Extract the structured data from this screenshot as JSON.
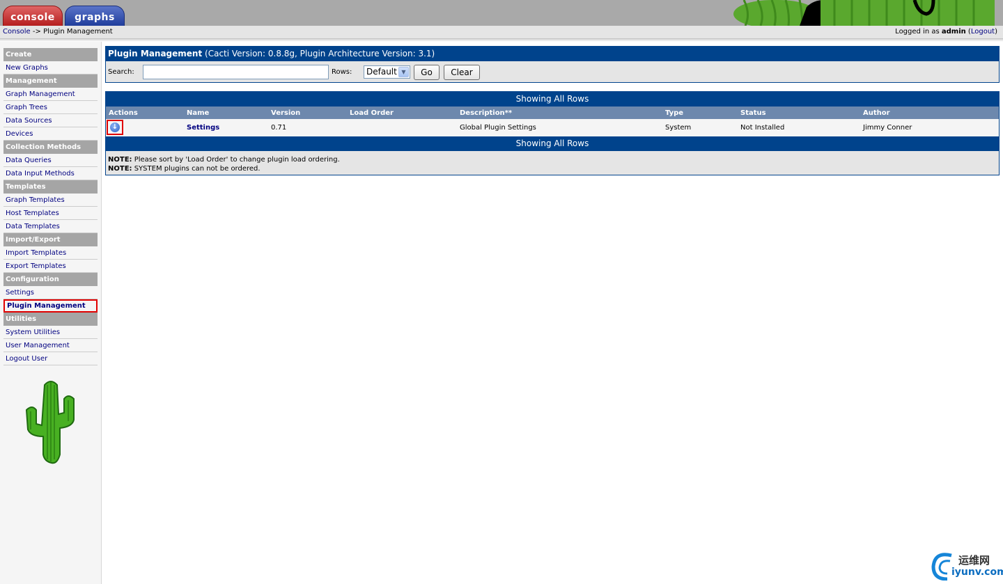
{
  "tabs": {
    "console": "console",
    "graphs": "graphs"
  },
  "breadcrumb": {
    "link": "Console",
    "separator": " -> ",
    "current": "Plugin Management"
  },
  "login": {
    "prefix": "Logged in as ",
    "user": "admin",
    "logout_open": " (",
    "logout": "Logout",
    "logout_close": ")"
  },
  "sidebar": {
    "sections": [
      {
        "header": "Create",
        "items": [
          "New Graphs"
        ]
      },
      {
        "header": "Management",
        "items": [
          "Graph Management",
          "Graph Trees",
          "Data Sources",
          "Devices"
        ]
      },
      {
        "header": "Collection Methods",
        "items": [
          "Data Queries",
          "Data Input Methods"
        ]
      },
      {
        "header": "Templates",
        "items": [
          "Graph Templates",
          "Host Templates",
          "Data Templates"
        ]
      },
      {
        "header": "Import/Export",
        "items": [
          "Import Templates",
          "Export Templates"
        ]
      },
      {
        "header": "Configuration",
        "items": [
          "Settings",
          "Plugin Management"
        ]
      },
      {
        "header": "Utilities",
        "items": [
          "System Utilities",
          "User Management",
          "Logout User"
        ]
      }
    ],
    "selected": "Plugin Management"
  },
  "main": {
    "title": "Plugin Management",
    "title_detail": " (Cacti Version: 0.8.8g, Plugin Architecture Version: 3.1)",
    "filter": {
      "search_label": "Search:",
      "search_value": "",
      "rows_label": "Rows:",
      "rows_value": "Default",
      "go": "Go",
      "clear": "Clear"
    },
    "table": {
      "top_bar": "Showing All Rows",
      "bottom_bar": "Showing All Rows",
      "columns": [
        "Actions",
        "Name",
        "Version",
        "Load Order",
        "Description**",
        "Type",
        "Status",
        "Author"
      ],
      "rows": [
        {
          "action_icon": "install-icon",
          "name": "Settings",
          "version": "0.71",
          "load_order": "",
          "description": "Global Plugin Settings",
          "type": "System",
          "status": "Not Installed",
          "author": "Jimmy Conner"
        }
      ]
    },
    "notes": [
      {
        "label": "NOTE:",
        "text": " Please sort by 'Load Order' to change plugin load ordering."
      },
      {
        "label": "NOTE:",
        "text": " SYSTEM plugins can not be ordered."
      }
    ]
  },
  "watermark": {
    "line1": "运维网",
    "line2": "iyunv.com"
  },
  "colors": {
    "header_blue": "#00438c",
    "column_header": "#6d88ad",
    "menu_header": "#a5a5a5",
    "link": "#000080",
    "highlight": "#e00000"
  }
}
